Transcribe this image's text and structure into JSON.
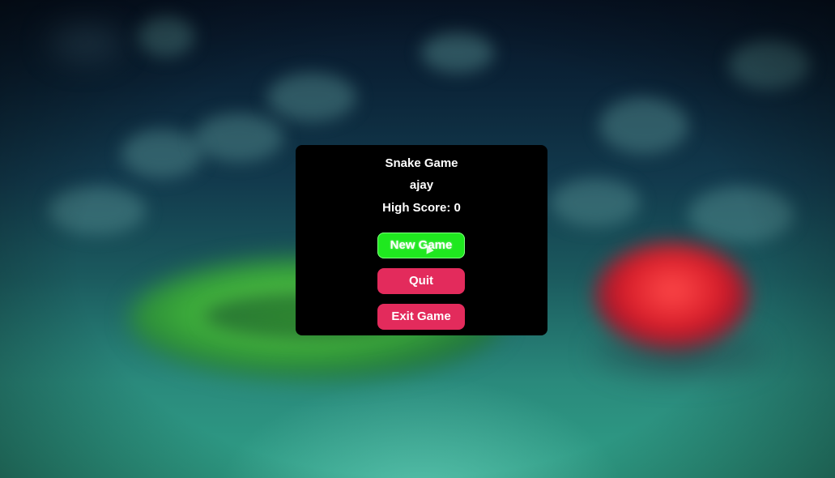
{
  "menu": {
    "title": "Snake Game",
    "player_name": "ajay",
    "high_score_text": "High Score: 0"
  },
  "buttons": {
    "new_game": "New Game",
    "quit": "Quit",
    "exit_game": "Exit Game"
  },
  "colors": {
    "panel_background": "#000000",
    "new_game_button": "#1fe81f",
    "secondary_button": "#e32b5c",
    "text": "#ffffff"
  },
  "background": {
    "description_icons": [
      "blurred-snake-icon",
      "blurred-apple-icon"
    ]
  }
}
